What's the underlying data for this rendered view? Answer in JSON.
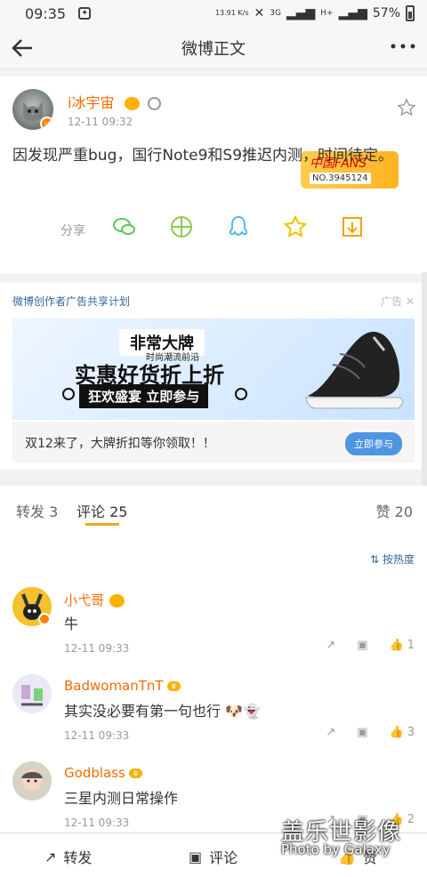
{
  "status_bar": {
    "time": "09:35",
    "speed": "13.91\nK/s",
    "network_3g": "3G",
    "network_h": "H+",
    "battery": "57%"
  },
  "nav": {
    "title": "微博正文"
  },
  "post": {
    "author": "i冰宇宙",
    "timestamp": "12-11 09:32",
    "text": "因发现严重bug，国行Note9和S9推迟内测，时间待定。",
    "fans_badge_top": "中国FANS",
    "fans_badge_no": "NO.3945124",
    "share_label": "分享"
  },
  "ad": {
    "label": "微博创作者广告共享计划",
    "tag": "广告",
    "banner_line1": "非常大牌",
    "banner_line2": "时尚潮流前沿",
    "banner_line3": "实惠好货折上折",
    "banner_line4": "狂欢盛宴 立即参与",
    "text": "双12来了，大牌折扣等你领取！！",
    "button": "立即参与"
  },
  "tabs": {
    "repost": "转发 3",
    "comment": "评论 25",
    "like": "赞 20"
  },
  "sort": {
    "label": "按热度"
  },
  "comments": [
    {
      "name": "小弋哥",
      "text": "牛",
      "time": "12-11 09:33",
      "likes": "1",
      "avatar_color": "#f4c22b"
    },
    {
      "name": "BadwomanTnT",
      "text": "其实没必要有第一句也行",
      "time": "12-11 09:33",
      "likes": "3",
      "avatar_color": "#e9e9f6"
    },
    {
      "name": "Godblass",
      "text": "三星内测日常操作",
      "time": "12-11 09:33",
      "likes": "2",
      "avatar_color": "#d8d2c6"
    }
  ],
  "bottom_bar": {
    "repost": "转发",
    "comment": "评论",
    "like": "赞"
  },
  "watermark": {
    "line1": "盖乐世影像",
    "line2": "Photo by Galaxy"
  }
}
